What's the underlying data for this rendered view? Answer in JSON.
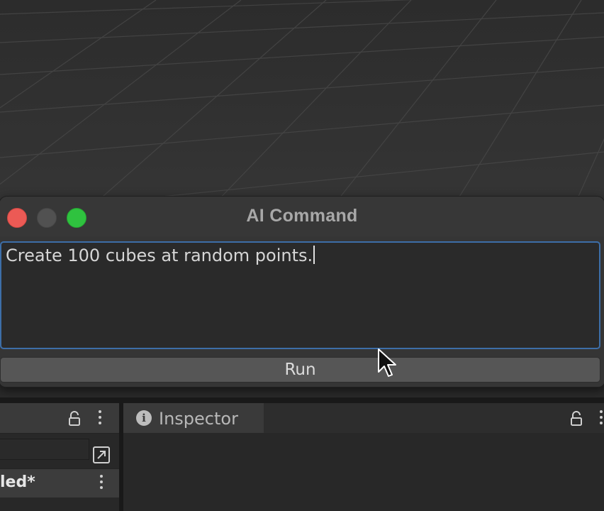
{
  "window": {
    "title": "AI Command",
    "command_text": "Create 100 cubes at random points.",
    "run_label": "Run"
  },
  "hierarchy": {
    "scene_name": "led*"
  },
  "inspector": {
    "tab_label": "Inspector",
    "info_glyph": "i"
  },
  "icons": [
    "close-icon",
    "minimize-icon",
    "maximize-icon",
    "lock-icon",
    "kebab-menu-icon",
    "expand-window-icon",
    "info-icon",
    "mouse-cursor-icon"
  ],
  "colors": {
    "accent_border": "#3d6ea8",
    "traffic_red": "#ec5a55",
    "traffic_green": "#2fc23f"
  }
}
